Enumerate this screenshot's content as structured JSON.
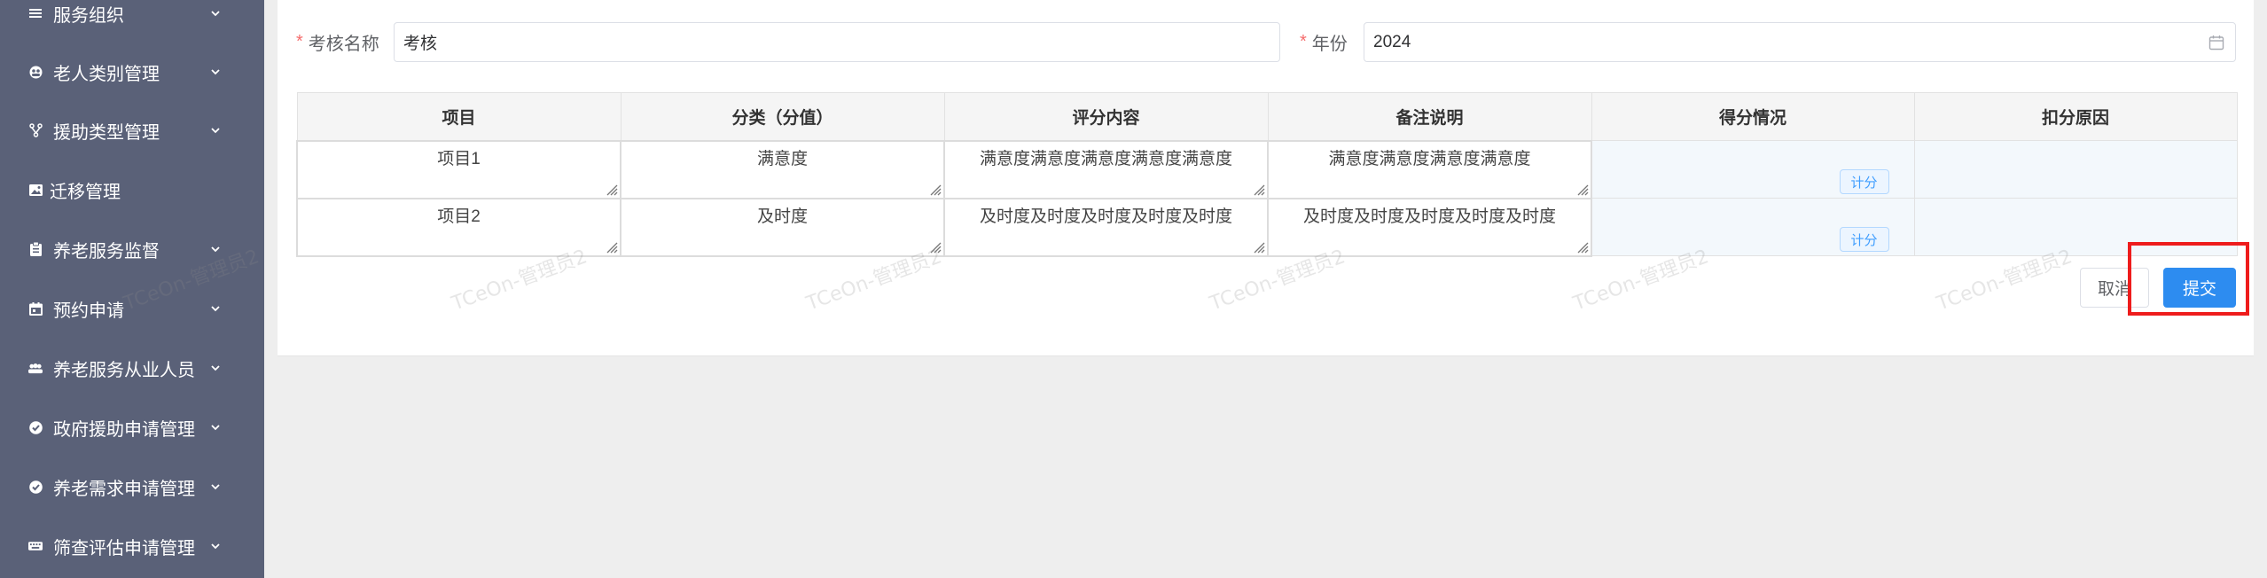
{
  "sidebar": {
    "items": [
      {
        "label": "服务组织",
        "icon": "list-icon",
        "has_children": true
      },
      {
        "label": "老人类别管理",
        "icon": "user-group-icon",
        "has_children": true
      },
      {
        "label": "援助类型管理",
        "icon": "branch-icon",
        "has_children": true
      },
      {
        "label": "迁移管理",
        "icon": "image-icon",
        "has_children": false
      },
      {
        "label": "养老服务监督",
        "icon": "clipboard-icon",
        "has_children": true
      },
      {
        "label": "预约申请",
        "icon": "calendar-icon",
        "has_children": true
      },
      {
        "label": "养老服务从业人员",
        "icon": "people-icon",
        "has_children": true
      },
      {
        "label": "政府援助申请管理",
        "icon": "check-circle-icon",
        "has_children": true
      },
      {
        "label": "养老需求申请管理",
        "icon": "check-circle-icon",
        "has_children": true
      },
      {
        "label": "筛查评估申请管理",
        "icon": "keyboard-icon",
        "has_children": true
      }
    ]
  },
  "form": {
    "name_label": "考核名称",
    "name_value": "考核",
    "year_label": "年份",
    "year_value": "2024",
    "required_mark": "*"
  },
  "table": {
    "headers": [
      "项目",
      "分类（分值）",
      "评分内容",
      "备注说明",
      "得分情况",
      "扣分原因"
    ],
    "rows": [
      {
        "item": "项目1",
        "category": "满意度",
        "content": "满意度满意度满意度满意度满意度",
        "note": "满意度满意度满意度满意度",
        "score_button": "计分",
        "reason": ""
      },
      {
        "item": "项目2",
        "category": "及时度",
        "content": "及时度及时度及时度及时度及时度",
        "note": "及时度及时度及时度及时度及时度",
        "score_button": "计分",
        "reason": ""
      }
    ]
  },
  "actions": {
    "cancel_label": "取消",
    "submit_label": "提交"
  },
  "watermark": "TCeOn-管理员2",
  "colors": {
    "sidebar_bg": "#5a6178",
    "primary": "#2d8cf0",
    "required": "#f56c6c",
    "highlight": "#ee1c1c"
  }
}
